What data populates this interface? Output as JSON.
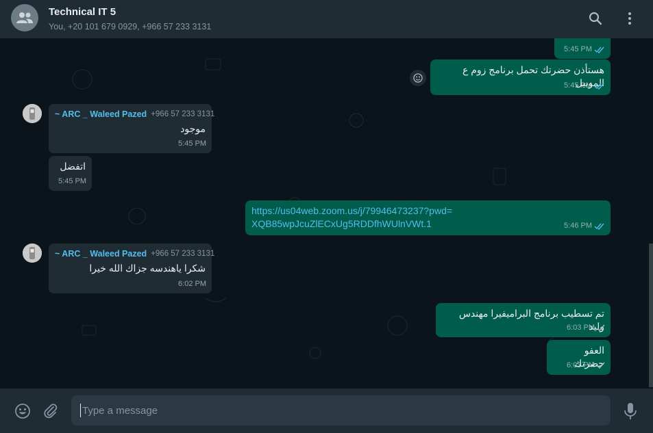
{
  "header": {
    "title": "Technical IT 5",
    "subtitle": "You, +20 101 679 0929, +966 57 233 3131"
  },
  "messages": [
    {
      "id": "m0",
      "text": "",
      "time": "5:45 PM"
    },
    {
      "id": "m1",
      "text": "هستأذن حضرتك تحمل برنامج زوم ع الموبيل",
      "time": "5:45 PM"
    },
    {
      "id": "m2",
      "sender": "~ ARC _ Waleed Pazed",
      "phone": "+966 57 233 3131",
      "text": "موجود",
      "time": "5:45 PM"
    },
    {
      "id": "m3",
      "text": "اتفضل",
      "time": "5:45 PM"
    },
    {
      "id": "m4",
      "text": "https://us04web.zoom.us/j/79946473237?pwd=XQB85wpJcuZlECxUg5RDDfhWUlnVWt.1",
      "time": "5:46 PM"
    },
    {
      "id": "m5",
      "sender": "~ ARC _ Waleed Pazed",
      "phone": "+966 57 233 3131",
      "text": "شكرا ياهندسه جزاك الله خيرا",
      "time": "6:02 PM"
    },
    {
      "id": "m6",
      "text": "تم تسطيب برنامج البراميفيرا  مهندس وليد",
      "time": "6:03 PM"
    },
    {
      "id": "m7",
      "text": "العفو حضرتك",
      "time": "6:03 PM"
    }
  ],
  "composer": {
    "placeholder": "Type a message"
  },
  "colors": {
    "outgoing": "#005c4b",
    "incoming": "#202c33",
    "background": "#0b141a",
    "accent_link": "#53bdeb",
    "read_ticks": "#53bdeb"
  },
  "icons": [
    "group-avatar-icon",
    "search-icon",
    "menu-icon",
    "emoji-icon",
    "attach-icon",
    "mic-icon",
    "read-receipt-icon",
    "sent-receipt-icon",
    "reaction-icon"
  ]
}
